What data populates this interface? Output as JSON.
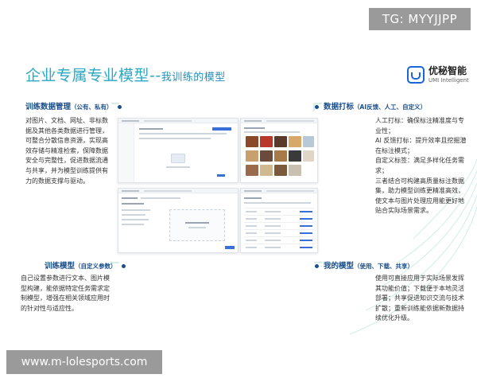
{
  "tag_label": "TG: MYYJJPP",
  "watermark_url": "www.m-lolesports.com",
  "title": {
    "main": "企业专属专业模型",
    "separator": "--",
    "sub": "我训练的模型"
  },
  "logo": {
    "cn": "优秘智能",
    "en": "UMI Intelligent"
  },
  "sections": {
    "data_mgmt": {
      "title": "训练数据管理",
      "paren": "（公有、私有）",
      "lines": [
        "对图片、文档、网址、非标数",
        "据及其他各类数据进行管理，",
        "可整合分散信息资源，实现高",
        "效存储与精准检索，保障数据",
        "安全与完整性，促进数据流通",
        "与共享，并为模型训练提供有",
        "力的数据支撑与驱动。"
      ]
    },
    "annotation": {
      "title": "数据打标",
      "paren": "（AI反馈、人工、自定义）",
      "lines": [
        "人工打标：确保标注精准度与专",
        "业性；",
        "AI 反馈打标：提升效率且挖掘潜",
        "在标注模式；",
        "自定义标签：满足多样化任务需",
        "求；",
        "三者结合可构建高质量标注数据",
        "集，助力模型训练更精准高效，",
        "使文本与图片处理应用能更好地",
        "贴合实际场景需求。"
      ]
    },
    "training": {
      "title": "训练模型",
      "paren": "（自定义参数）",
      "lines": [
        "自己设置参数进行文本、图片模",
        "型构建，能依据特定任务需求定",
        "制模型，增强在相关领域应用时",
        "的针对性与适应性。"
      ]
    },
    "my_models": {
      "title": "我的模型",
      "paren": "（使用、下载、共享）",
      "lines": [
        "使用可直接应用于实际场景发挥",
        "其功能价值；下载便于本地灵活",
        "部署；共享促进知识交流与技术",
        "扩散；重新训练能依据新数据持",
        "续优化升级。"
      ]
    }
  },
  "colors": {
    "title": "#2aa8c4",
    "section": "#1b4f8c",
    "accent": "#3a6fd8",
    "badge": "#9a9a9a"
  }
}
